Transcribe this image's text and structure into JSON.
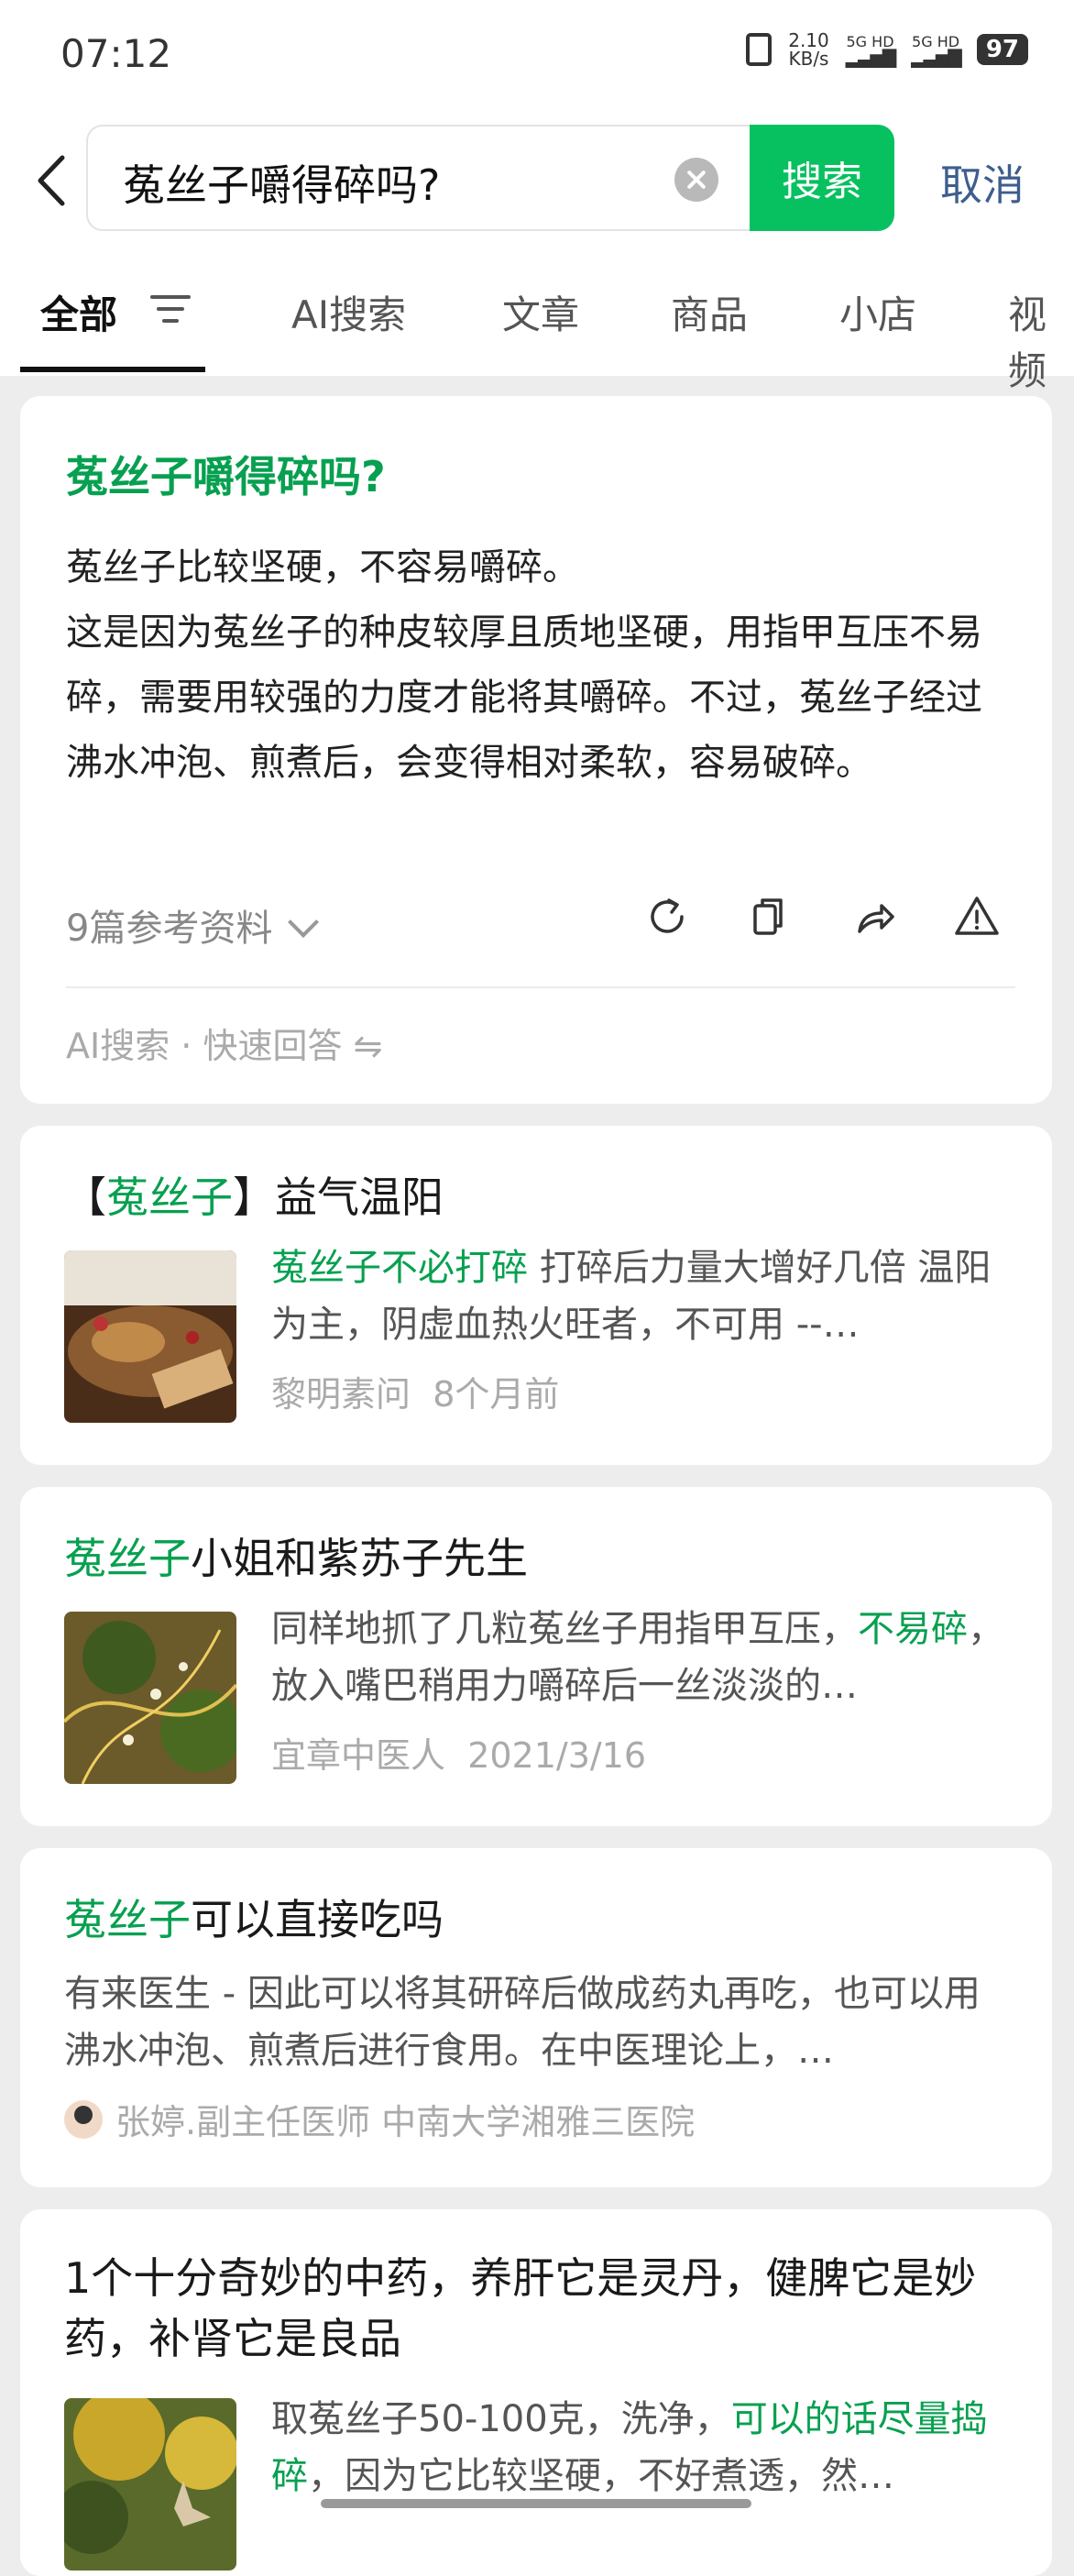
{
  "status": {
    "time": "07:12",
    "speed_top": "2.10",
    "speed_unit": "KB/s",
    "sig1": "5G HD",
    "sig2": "5G HD",
    "battery": "97"
  },
  "search": {
    "query": "菟丝子嚼得碎吗?",
    "search_label": "搜索",
    "cancel_label": "取消",
    "back_icon": "back-arrow-icon",
    "clear_icon": "clear-icon"
  },
  "tabs": [
    "全部",
    "AI搜索",
    "文章",
    "商品",
    "小店",
    "视频"
  ],
  "ai_answer": {
    "title": "菟丝子嚼得碎吗?",
    "line1": "菟丝子比较坚硬，不容易嚼碎。",
    "line2": "这是因为菟丝子的种皮较厚且质地坚硬，用指甲互压不易碎，需要用较强的力度才能将其嚼碎。不过，菟丝子经过沸水冲泡、煎煮后，会变得相对柔软，容易破碎。",
    "refs": "9篇参考资料",
    "footer": "AI搜索 · 快速回答 ⇋"
  },
  "results": [
    {
      "title_pre": "【",
      "title_hl": "菟丝子",
      "title_post": "】益气温阳",
      "snip_hl": "菟丝子不必打碎",
      "snip_rest": " 打碎后力量大增好几倍 温阳为主，阴虚血热火旺者，不可用 --…",
      "source": "黎明素问",
      "date": "8个月前"
    },
    {
      "title_hl": "菟丝子",
      "title_post": "小姐和紫苏子先生",
      "snip_pre": "同样地抓了几粒菟丝子用指甲互压，",
      "snip_hl": "不易碎",
      "snip_rest": "，放入嘴巴稍用力嚼碎后一丝淡淡的…",
      "source": "宜章中医人",
      "date": "2021/3/16"
    },
    {
      "title_hl": "菟丝子",
      "title_post": "可以直接吃吗",
      "snip": "有来医生 - 因此可以将其研碎后做成药丸再吃，也可以用沸水冲泡、煎煮后进行食用。在中医理论上，…",
      "author": "张婷.副主任医师 中南大学湘雅三医院"
    },
    {
      "title": "1个十分奇妙的中药，养肝它是灵丹，健脾它是妙药，补肾它是良品",
      "snip_pre": "取菟丝子50-100克，洗净，",
      "snip_hl": "可以的话尽量捣碎",
      "snip_rest": "，因为它比较坚硬，不好煮透，然…"
    }
  ]
}
